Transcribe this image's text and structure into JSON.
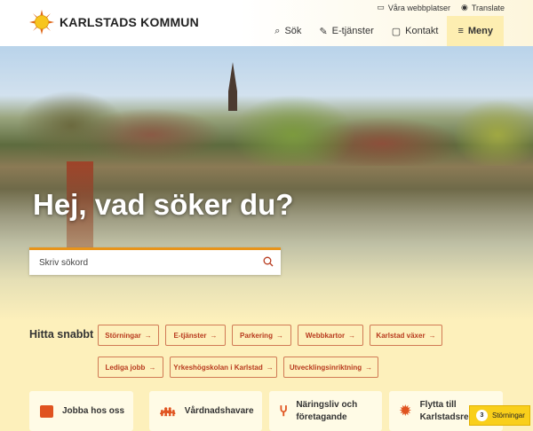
{
  "header": {
    "logo_text": "KARLSTADS KOMMUN",
    "util": {
      "sites": "Våra webbplatser",
      "translate": "Translate"
    },
    "nav": {
      "search": "Sök",
      "eservices": "E-tjänster",
      "contact": "Kontakt",
      "menu": "Meny"
    }
  },
  "hero": {
    "title": "Hej, vad söker du?",
    "search_placeholder": "Skriv sökord"
  },
  "quick": {
    "title": "Hitta snabbt",
    "links": [
      "Störningar",
      "E-tjänster",
      "Parkering",
      "Webbkartor",
      "Karlstad växer",
      "Lediga jobb",
      "Yrkeshögskolan i Karlstad",
      "Utvecklingsinriktning"
    ],
    "arrow": "→"
  },
  "cards": [
    "Jobba hos oss",
    "Vårdnadshavare",
    "Näringsliv och företagande",
    "Flytta till Karlstadsregionen"
  ],
  "badge": {
    "count": "3",
    "label": "Störningar"
  },
  "colors": {
    "accent": "#b83a1e",
    "yellow": "#fdf0bb",
    "card_icon": "#e0531f"
  }
}
